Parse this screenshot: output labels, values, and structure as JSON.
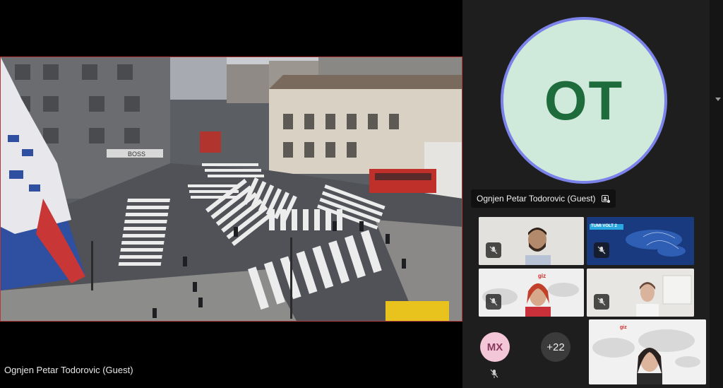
{
  "stage": {
    "presenter_name": "Ognjen Petar Todorovic (Guest)",
    "shop_sign": "BOSS"
  },
  "active_speaker": {
    "initials": "OT",
    "name": "Ognjen Petar Todorovic (Guest)",
    "avatar_bg": "#cfe9da",
    "ring_color": "#7b83eb"
  },
  "participants": {
    "tiles": [
      {
        "kind": "video-man",
        "muted": true
      },
      {
        "kind": "slide",
        "muted": true,
        "slide_text": "TUMI VOLT 2"
      },
      {
        "kind": "video-woman-giz",
        "muted": true,
        "logo_text": "giz"
      },
      {
        "kind": "video-woman-office",
        "muted": true
      },
      {
        "kind": "video-woman-map",
        "muted": false,
        "logo_text": "giz"
      }
    ],
    "mx_initials": "MX",
    "overflow_count": "+22"
  }
}
